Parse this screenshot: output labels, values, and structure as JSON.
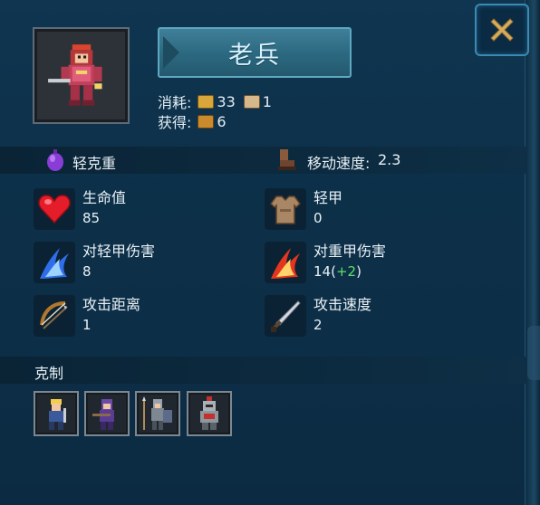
{
  "unit": {
    "name": "老兵",
    "armor_type": "轻克重",
    "move_speed_label": "移动速度:",
    "move_speed_value": "2.3"
  },
  "cost": {
    "label_consume": "消耗:",
    "consume_items": [
      {
        "icon": "gold-bar-icon",
        "value": "33"
      },
      {
        "icon": "population-icon",
        "value": "1"
      }
    ],
    "label_gain": "获得:",
    "gain_items": [
      {
        "icon": "treasure-icon",
        "value": "6"
      }
    ]
  },
  "stats": [
    {
      "icon": "heart-icon",
      "label": "生命值",
      "value": "85",
      "bonus": ""
    },
    {
      "icon": "armor-icon",
      "label": "轻甲",
      "value": "0",
      "bonus": ""
    },
    {
      "icon": "blue-slash-icon",
      "label": "对轻甲伤害",
      "value": "8",
      "bonus": ""
    },
    {
      "icon": "red-slash-icon",
      "label": "对重甲伤害",
      "value": "14(",
      "bonus": "+2",
      "suffix": ")"
    },
    {
      "icon": "bow-icon",
      "label": "攻击距离",
      "value": "1",
      "bonus": ""
    },
    {
      "icon": "sword-icon",
      "label": "攻击速度",
      "value": "2",
      "bonus": ""
    }
  ],
  "counters": {
    "title": "克制",
    "units": [
      {
        "icon": "blonde-swordsman-icon"
      },
      {
        "icon": "purple-crossbowman-icon"
      },
      {
        "icon": "spearman-shield-icon"
      },
      {
        "icon": "heavy-knight-icon"
      }
    ]
  },
  "colors": {
    "panel_bg": "#0d3049",
    "accent_border": "#3a8ab3",
    "close_icon": "#d6ad60",
    "bonus_green": "#5fe06a"
  }
}
